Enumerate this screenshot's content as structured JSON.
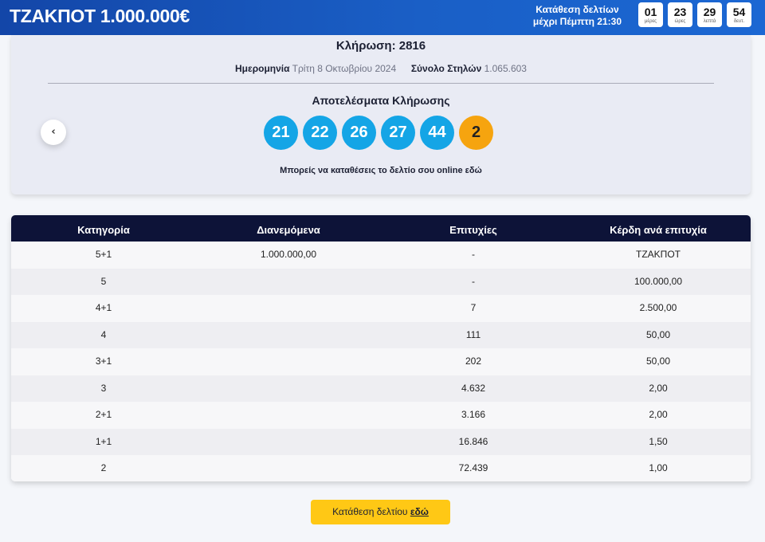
{
  "header": {
    "jackpot": "ΤΖΑΚΠΟΤ 1.000.000€",
    "deadline_line1": "Κατάθεση δελτίων",
    "deadline_line2": "μέχρι Πέμπτη 21:30",
    "countdown": [
      {
        "value": "01",
        "label": "μέρες"
      },
      {
        "value": "23",
        "label": "ώρες"
      },
      {
        "value": "29",
        "label": "λεπτά"
      },
      {
        "value": "54",
        "label": "δευτ."
      }
    ]
  },
  "draw": {
    "title": "Κλήρωση: 2816",
    "date_label": "Ημερομηνία",
    "date_value": "Τρίτη 8 Οκτωβρίου 2024",
    "columns_label": "Σύνολο Στηλών",
    "columns_value": "1.065.603",
    "results_title": "Αποτελέσματα Κλήρωσης",
    "numbers": [
      "21",
      "22",
      "26",
      "27",
      "44"
    ],
    "bonus": "2",
    "online_text": "Μπορείς να καταθέσεις το δελτίο σου online",
    "online_link": "εδώ",
    "colors": {
      "number_ball": "#14a5e6",
      "bonus_ball": "#f6a40f"
    }
  },
  "table": {
    "headers": [
      "Κατηγορία",
      "Διανεμόμενα",
      "Επιτυχίες",
      "Κέρδη ανά επιτυχία"
    ],
    "rows": [
      [
        "5+1",
        "1.000.000,00",
        "-",
        "ΤΖΑΚΠΟΤ"
      ],
      [
        "5",
        "",
        "-",
        "100.000,00"
      ],
      [
        "4+1",
        "",
        "7",
        "2.500,00"
      ],
      [
        "4",
        "",
        "111",
        "50,00"
      ],
      [
        "3+1",
        "",
        "202",
        "50,00"
      ],
      [
        "3",
        "",
        "4.632",
        "2,00"
      ],
      [
        "2+1",
        "",
        "3.166",
        "2,00"
      ],
      [
        "1+1",
        "",
        "16.846",
        "1,50"
      ],
      [
        "2",
        "",
        "72.439",
        "1,00"
      ]
    ]
  },
  "footer": {
    "deposit_text": "Κατάθεση δελτίου",
    "deposit_link": "εδώ"
  }
}
